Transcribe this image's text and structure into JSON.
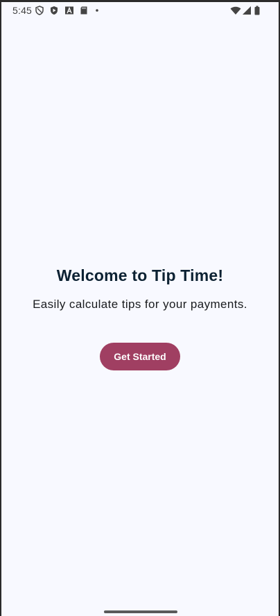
{
  "status_bar": {
    "time": "5:45",
    "left_icons": [
      "shield-outline-icon",
      "shield-play-icon",
      "font-a-icon",
      "sd-card-icon",
      "dot-icon"
    ],
    "right_icons": [
      "wifi-icon",
      "cell-signal-icon",
      "battery-icon"
    ]
  },
  "main": {
    "title": "Welcome to Tip Time!",
    "subtitle": "Easily calculate tips for your payments.",
    "button_label": "Get Started"
  },
  "colors": {
    "background": "#f8f9ff",
    "title": "#0d2233",
    "button": "#a03f62",
    "button_text": "#ffffff"
  }
}
